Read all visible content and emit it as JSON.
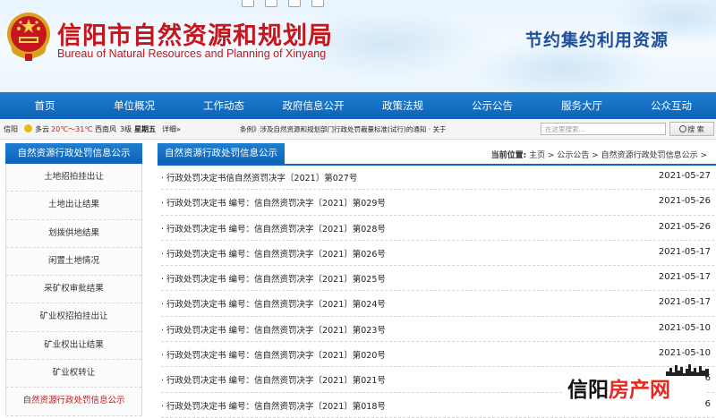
{
  "header": {
    "title_cn": "信阳市自然资源和规划局",
    "title_en": "Bureau of Natural Resources and Planning of Xinyang",
    "slogan": "节约集约利用资源"
  },
  "nav": {
    "items": [
      "首页",
      "单位概况",
      "工作动态",
      "政府信息公开",
      "政策法规",
      "公示公告",
      "服务大厅",
      "公众互动"
    ]
  },
  "infobar": {
    "city": "信阳",
    "weather": "多云",
    "temp": "20℃～31℃",
    "wind": "西南风",
    "wind_level": "3级",
    "weekday": "星期五",
    "detail_link": "详细»",
    "news_1": "条例》涉及自然资源和规划部门行政处罚裁量标准(试行)的通知",
    "news_2": "· 关于"
  },
  "search": {
    "placeholder": "在这里搜索...",
    "button_label": "搜 索"
  },
  "sidebar": {
    "heading": "自然资源行政处罚信息公示",
    "items": [
      "土地招拍挂出让",
      "土地出让结果",
      "划拨供地结果",
      "闲置土地情况",
      "采矿权审批结果",
      "矿业权招拍挂出让",
      "矿业权出让结果",
      "矿业权转让",
      "自然资源行政处罚信息公示"
    ]
  },
  "main": {
    "tab": "自然资源行政处罚信息公示",
    "crumb_label": "当前位置:",
    "crumb_path": "主页 > 公示公告 > 自然资源行政处罚信息公示 >",
    "rows": [
      {
        "title": "· 行政处罚决定书信自然资罚决字〔2021〕第027号",
        "date": "2021-05-27"
      },
      {
        "title": "· 行政处罚决定书 编号：信自然资罚决字〔2021〕第029号",
        "date": "2021-05-26"
      },
      {
        "title": "· 行政处罚决定书 编号：信自然资罚决字〔2021〕第028号",
        "date": "2021-05-26"
      },
      {
        "title": "· 行政处罚决定书 编号：信自然资罚决字〔2021〕第026号",
        "date": "2021-05-17"
      },
      {
        "title": "· 行政处罚决定书 编号：信自然资罚决字〔2021〕第025号",
        "date": "2021-05-17"
      },
      {
        "title": "· 行政处罚决定书 编号：信自然资罚决字〔2021〕第024号",
        "date": "2021-05-17"
      },
      {
        "title": "· 行政处罚决定书 编号：信自然资罚决字〔2021〕第023号",
        "date": "2021-05-10"
      },
      {
        "title": "· 行政处罚决定书 编号：信自然资罚决字〔2021〕第020号",
        "date": "2021-05-10"
      },
      {
        "title": "· 行政处罚决定书 编号：信自然资罚决字〔2021〕第021号",
        "date": "6"
      },
      {
        "title": "· 行政处罚决定书 编号：信自然资罚决字〔2021〕第018号",
        "date": "6"
      }
    ]
  },
  "watermark": {
    "part_1": "信阳",
    "part_2": "房产网"
  },
  "colors": {
    "brand_red": "#c4161c",
    "nav_blue": "#0d62b8",
    "slogan_blue": "#1d4f9a"
  },
  "icons": [
    "national-emblem-icon",
    "sun-weather-icon",
    "toolbar-icons"
  ]
}
